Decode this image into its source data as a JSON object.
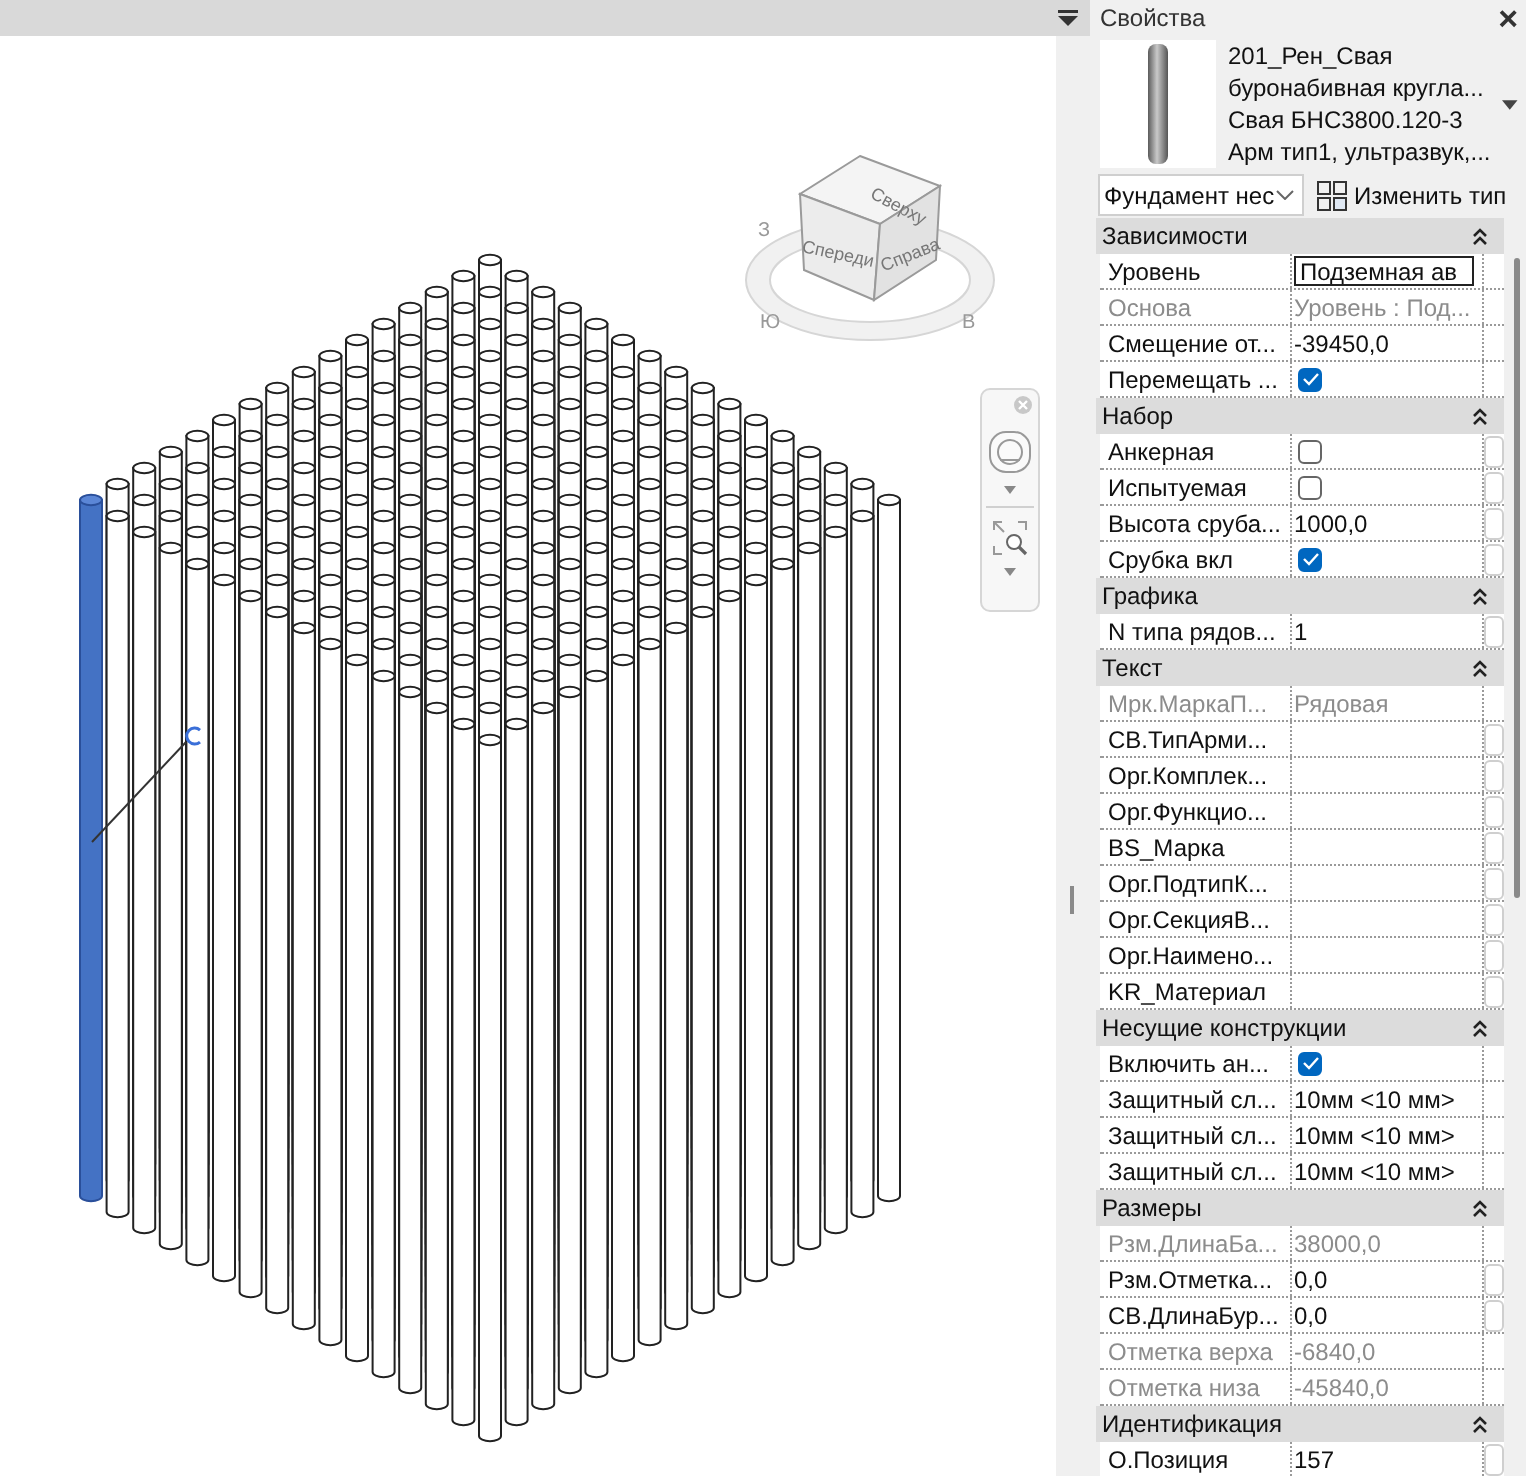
{
  "view": {
    "cube": {
      "top": "Сверху",
      "front": "Спереди",
      "right": "Справа"
    },
    "compass": [
      "З",
      "Ю",
      "В"
    ]
  },
  "properties": {
    "title": "Свойства",
    "close": "×",
    "type_lines": [
      "201_Рен_Свая",
      "буронабивная кругла...",
      "Свая БНС3800.120-3",
      "Арм тип1, ультразвук,..."
    ],
    "instance_filter": "Фундамент нес",
    "edit_type": "Изменить тип",
    "groups": [
      {
        "title": "Зависимости",
        "rows": [
          {
            "name": "Уровень",
            "value": "Подземная ав",
            "kind": "input",
            "disabled": false,
            "associate_button": false
          },
          {
            "name": "Основа",
            "value": "Уровень : Под...",
            "kind": "text",
            "disabled": true,
            "associate_button": false
          },
          {
            "name": "Смещение от...",
            "value": "-39450,0",
            "kind": "text",
            "disabled": false,
            "associate_button": false
          },
          {
            "name": "Перемещать ...",
            "kind": "check",
            "checked": true,
            "disabled": false,
            "associate_button": false
          }
        ]
      },
      {
        "title": "Набор",
        "rows": [
          {
            "name": "Анкерная",
            "kind": "check",
            "checked": false,
            "disabled": false,
            "associate_button": true
          },
          {
            "name": "Испытуемая",
            "kind": "check",
            "checked": false,
            "disabled": false,
            "associate_button": true
          },
          {
            "name": "Высота сруба...",
            "value": "1000,0",
            "kind": "text",
            "disabled": false,
            "associate_button": true
          },
          {
            "name": "Срубка вкл",
            "kind": "check",
            "checked": true,
            "disabled": false,
            "associate_button": true
          }
        ]
      },
      {
        "title": "Графика",
        "rows": [
          {
            "name": "N типа рядов...",
            "value": "1",
            "kind": "text",
            "disabled": false,
            "associate_button": true
          }
        ]
      },
      {
        "title": "Текст",
        "rows": [
          {
            "name": "Мрк.МаркаП...",
            "value": "Рядовая",
            "kind": "text",
            "disabled": true,
            "associate_button": false
          },
          {
            "name": "СВ.ТипАрми...",
            "kind": "text",
            "disabled": false,
            "associate_button": true
          },
          {
            "name": "Орг.Комплек...",
            "kind": "text",
            "disabled": false,
            "associate_button": true
          },
          {
            "name": "Орг.Функцио...",
            "kind": "text",
            "disabled": false,
            "associate_button": true
          },
          {
            "name": "BS_Марка",
            "kind": "text",
            "disabled": false,
            "associate_button": true
          },
          {
            "name": "Орг.ПодтипК...",
            "kind": "text",
            "disabled": false,
            "associate_button": true
          },
          {
            "name": "Орг.СекцияВ...",
            "kind": "text",
            "disabled": false,
            "associate_button": true
          },
          {
            "name": "Орг.Наимено...",
            "kind": "text",
            "disabled": false,
            "associate_button": true
          },
          {
            "name": "KR_Материал",
            "kind": "text",
            "disabled": false,
            "associate_button": true
          }
        ]
      },
      {
        "title": "Несущие конструкции",
        "rows": [
          {
            "name": "Включить ан...",
            "kind": "check",
            "checked": true,
            "disabled": false,
            "associate_button": false
          },
          {
            "name": "Защитный сл...",
            "value": "10мм <10 мм>",
            "kind": "text",
            "disabled": false,
            "associate_button": false
          },
          {
            "name": "Защитный сл...",
            "value": "10мм <10 мм>",
            "kind": "text",
            "disabled": false,
            "associate_button": false
          },
          {
            "name": "Защитный сл...",
            "value": "10мм <10 мм>",
            "kind": "text",
            "disabled": false,
            "associate_button": false
          }
        ]
      },
      {
        "title": "Размеры",
        "rows": [
          {
            "name": "Рзм.ДлинаБа...",
            "value": "38000,0",
            "kind": "text",
            "disabled": true,
            "associate_button": false
          },
          {
            "name": "Рзм.Отметка...",
            "value": "0,0",
            "kind": "text",
            "disabled": false,
            "associate_button": true
          },
          {
            "name": "СВ.ДлинаБур...",
            "value": "0,0",
            "kind": "text",
            "disabled": false,
            "associate_button": true
          },
          {
            "name": "Отметка верха",
            "value": "-6840,0",
            "kind": "text",
            "disabled": true,
            "associate_button": false
          },
          {
            "name": "Отметка низа",
            "value": "-45840,0",
            "kind": "text",
            "disabled": true,
            "associate_button": false
          }
        ]
      },
      {
        "title": "Идентификация",
        "rows": [
          {
            "name": "О.Позиция",
            "value": "157",
            "kind": "text",
            "disabled": false,
            "associate_button": true
          }
        ]
      }
    ]
  }
}
